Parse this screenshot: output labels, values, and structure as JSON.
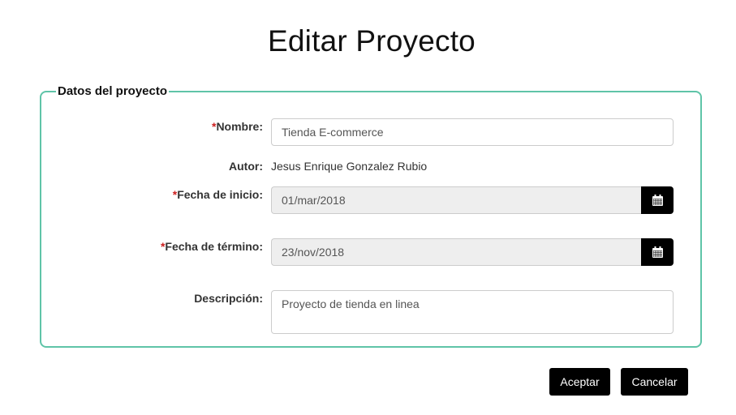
{
  "page": {
    "title": "Editar Proyecto"
  },
  "form": {
    "legend": "Datos del proyecto",
    "required_mark": "*",
    "nombre": {
      "label": "Nombre:",
      "value": "Tienda E-commerce"
    },
    "autor": {
      "label": "Autor:",
      "value": "Jesus Enrique Gonzalez Rubio"
    },
    "fecha_inicio": {
      "label": "Fecha de inicio:",
      "value": "01/mar/2018",
      "icon": "calendar-icon"
    },
    "fecha_termino": {
      "label": "Fecha de término:",
      "value": "23/nov/2018",
      "icon": "calendar-icon"
    },
    "descripcion": {
      "label": "Descripción:",
      "value": "Proyecto de tienda en linea"
    }
  },
  "actions": {
    "accept_label": "Aceptar",
    "cancel_label": "Cancelar"
  },
  "colors": {
    "panel_border": "#5fc4a8",
    "required": "#cc1f1f",
    "button_bg": "#000000",
    "readonly_bg": "#eeeeee"
  }
}
